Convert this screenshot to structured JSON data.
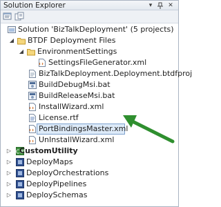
{
  "window": {
    "title": "Solution Explorer",
    "pin_icon": "pin-icon",
    "close_icon": "close-icon",
    "dropdown_icon": "dropdown-icon"
  },
  "toolbar": {
    "icons": [
      "properties-icon",
      "show-all-files-icon"
    ]
  },
  "tree": {
    "solution": {
      "label": "Solution 'BizTalkDeployment' (5 projects)",
      "icon": "solution-icon"
    },
    "btdf": {
      "label": "BTDF Deployment Files",
      "icon": "folder-icon"
    },
    "env": {
      "label": "EnvironmentSettings",
      "icon": "folder-icon"
    },
    "items": [
      {
        "label": "SettingsFileGenerator.xml",
        "icon": "xml-file-icon"
      },
      {
        "label": "BizTalkDeployment.Deployment.btdfproj",
        "icon": "project-file-icon"
      },
      {
        "label": "BuildDebugMsi.bat",
        "icon": "bat-file-icon"
      },
      {
        "label": "BuildReleaseMsi.bat",
        "icon": "bat-file-icon"
      },
      {
        "label": "InstallWizard.xml",
        "icon": "xml-file-icon"
      },
      {
        "label": "License.rtf",
        "icon": "rtf-file-icon"
      },
      {
        "label": "PortBindingsMaster.xml",
        "icon": "xml-file-icon"
      },
      {
        "label": "UnInstallWizard.xml",
        "icon": "xml-file-icon"
      }
    ],
    "projects": [
      {
        "label": "CustomUtility",
        "icon": "csharp-project-icon"
      },
      {
        "label": "DeployMaps",
        "icon": "biztalk-project-icon"
      },
      {
        "label": "DeployOrchestrations",
        "icon": "biztalk-project-icon"
      },
      {
        "label": "DeployPipelines",
        "icon": "biztalk-project-icon"
      },
      {
        "label": "DeploySchemas",
        "icon": "biztalk-project-icon"
      }
    ]
  },
  "colors": {
    "selection_bg": "#ddeaf8",
    "selection_border": "#7da2ce",
    "arrow_green": "#2f8f2f"
  }
}
